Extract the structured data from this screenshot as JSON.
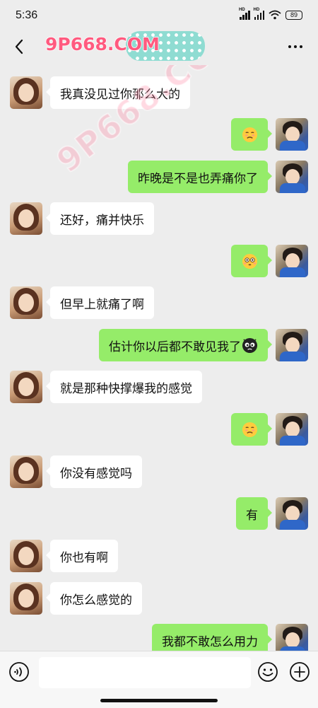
{
  "status_bar": {
    "time": "5:36",
    "battery": "89",
    "signal_label": "HD"
  },
  "nav": {
    "watermark": "9P668.COM"
  },
  "diagonal_watermark": "9P668.COM",
  "messages": [
    {
      "side": "left",
      "text": "我真没见过你那么大的"
    },
    {
      "side": "right",
      "text": "",
      "emoji": "pouting-face-emoji"
    },
    {
      "side": "right",
      "text": "昨晚是不是也弄痛你了"
    },
    {
      "side": "left",
      "text": "还好，痛并快乐"
    },
    {
      "side": "right",
      "text": "",
      "emoji": "flushed-face-emoji"
    },
    {
      "side": "left",
      "text": "但早上就痛了啊"
    },
    {
      "side": "right",
      "text": "估计你以后都不敢见我了",
      "emoji": "dizzy-face-emoji"
    },
    {
      "side": "left",
      "text": "就是那种快撑爆我的感觉"
    },
    {
      "side": "right",
      "text": "",
      "emoji": "pouting-face-emoji"
    },
    {
      "side": "left",
      "text": "你没有感觉吗"
    },
    {
      "side": "right",
      "text": "有"
    },
    {
      "side": "left",
      "text": "你也有啊"
    },
    {
      "side": "left",
      "text": "你怎么感觉的"
    },
    {
      "side": "right",
      "text": "我都不敢怎么用力"
    }
  ],
  "input_bar": {
    "placeholder": ""
  },
  "colors": {
    "background": "#ededed",
    "self_bubble": "#95ec69",
    "other_bubble": "#ffffff",
    "watermark": "#ff5a7f"
  }
}
